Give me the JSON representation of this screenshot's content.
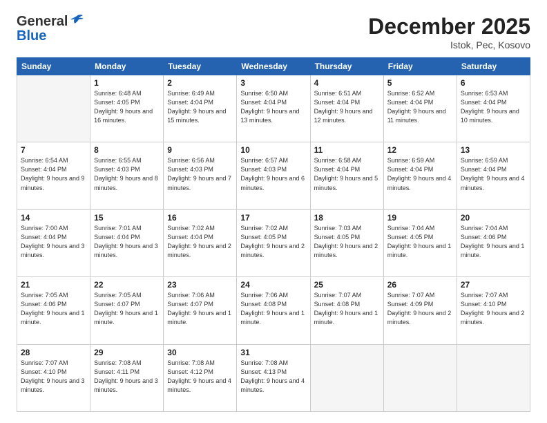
{
  "header": {
    "logo_general": "General",
    "logo_blue": "Blue",
    "month_title": "December 2025",
    "location": "Istok, Pec, Kosovo"
  },
  "days_of_week": [
    "Sunday",
    "Monday",
    "Tuesday",
    "Wednesday",
    "Thursday",
    "Friday",
    "Saturday"
  ],
  "weeks": [
    [
      {
        "day": "",
        "empty": true
      },
      {
        "day": "1",
        "sunrise": "6:48 AM",
        "sunset": "4:05 PM",
        "daylight": "9 hours and 16 minutes."
      },
      {
        "day": "2",
        "sunrise": "6:49 AM",
        "sunset": "4:04 PM",
        "daylight": "9 hours and 15 minutes."
      },
      {
        "day": "3",
        "sunrise": "6:50 AM",
        "sunset": "4:04 PM",
        "daylight": "9 hours and 13 minutes."
      },
      {
        "day": "4",
        "sunrise": "6:51 AM",
        "sunset": "4:04 PM",
        "daylight": "9 hours and 12 minutes."
      },
      {
        "day": "5",
        "sunrise": "6:52 AM",
        "sunset": "4:04 PM",
        "daylight": "9 hours and 11 minutes."
      },
      {
        "day": "6",
        "sunrise": "6:53 AM",
        "sunset": "4:04 PM",
        "daylight": "9 hours and 10 minutes."
      }
    ],
    [
      {
        "day": "7",
        "sunrise": "6:54 AM",
        "sunset": "4:04 PM",
        "daylight": "9 hours and 9 minutes."
      },
      {
        "day": "8",
        "sunrise": "6:55 AM",
        "sunset": "4:03 PM",
        "daylight": "9 hours and 8 minutes."
      },
      {
        "day": "9",
        "sunrise": "6:56 AM",
        "sunset": "4:03 PM",
        "daylight": "9 hours and 7 minutes."
      },
      {
        "day": "10",
        "sunrise": "6:57 AM",
        "sunset": "4:03 PM",
        "daylight": "9 hours and 6 minutes."
      },
      {
        "day": "11",
        "sunrise": "6:58 AM",
        "sunset": "4:04 PM",
        "daylight": "9 hours and 5 minutes."
      },
      {
        "day": "12",
        "sunrise": "6:59 AM",
        "sunset": "4:04 PM",
        "daylight": "9 hours and 4 minutes."
      },
      {
        "day": "13",
        "sunrise": "6:59 AM",
        "sunset": "4:04 PM",
        "daylight": "9 hours and 4 minutes."
      }
    ],
    [
      {
        "day": "14",
        "sunrise": "7:00 AM",
        "sunset": "4:04 PM",
        "daylight": "9 hours and 3 minutes."
      },
      {
        "day": "15",
        "sunrise": "7:01 AM",
        "sunset": "4:04 PM",
        "daylight": "9 hours and 3 minutes."
      },
      {
        "day": "16",
        "sunrise": "7:02 AM",
        "sunset": "4:04 PM",
        "daylight": "9 hours and 2 minutes."
      },
      {
        "day": "17",
        "sunrise": "7:02 AM",
        "sunset": "4:05 PM",
        "daylight": "9 hours and 2 minutes."
      },
      {
        "day": "18",
        "sunrise": "7:03 AM",
        "sunset": "4:05 PM",
        "daylight": "9 hours and 2 minutes."
      },
      {
        "day": "19",
        "sunrise": "7:04 AM",
        "sunset": "4:05 PM",
        "daylight": "9 hours and 1 minute."
      },
      {
        "day": "20",
        "sunrise": "7:04 AM",
        "sunset": "4:06 PM",
        "daylight": "9 hours and 1 minute."
      }
    ],
    [
      {
        "day": "21",
        "sunrise": "7:05 AM",
        "sunset": "4:06 PM",
        "daylight": "9 hours and 1 minute."
      },
      {
        "day": "22",
        "sunrise": "7:05 AM",
        "sunset": "4:07 PM",
        "daylight": "9 hours and 1 minute."
      },
      {
        "day": "23",
        "sunrise": "7:06 AM",
        "sunset": "4:07 PM",
        "daylight": "9 hours and 1 minute."
      },
      {
        "day": "24",
        "sunrise": "7:06 AM",
        "sunset": "4:08 PM",
        "daylight": "9 hours and 1 minute."
      },
      {
        "day": "25",
        "sunrise": "7:07 AM",
        "sunset": "4:08 PM",
        "daylight": "9 hours and 1 minute."
      },
      {
        "day": "26",
        "sunrise": "7:07 AM",
        "sunset": "4:09 PM",
        "daylight": "9 hours and 2 minutes."
      },
      {
        "day": "27",
        "sunrise": "7:07 AM",
        "sunset": "4:10 PM",
        "daylight": "9 hours and 2 minutes."
      }
    ],
    [
      {
        "day": "28",
        "sunrise": "7:07 AM",
        "sunset": "4:10 PM",
        "daylight": "9 hours and 3 minutes."
      },
      {
        "day": "29",
        "sunrise": "7:08 AM",
        "sunset": "4:11 PM",
        "daylight": "9 hours and 3 minutes."
      },
      {
        "day": "30",
        "sunrise": "7:08 AM",
        "sunset": "4:12 PM",
        "daylight": "9 hours and 4 minutes."
      },
      {
        "day": "31",
        "sunrise": "7:08 AM",
        "sunset": "4:13 PM",
        "daylight": "9 hours and 4 minutes."
      },
      {
        "day": "",
        "empty": true
      },
      {
        "day": "",
        "empty": true
      },
      {
        "day": "",
        "empty": true
      }
    ]
  ],
  "labels": {
    "sunrise": "Sunrise:",
    "sunset": "Sunset:",
    "daylight": "Daylight:"
  }
}
